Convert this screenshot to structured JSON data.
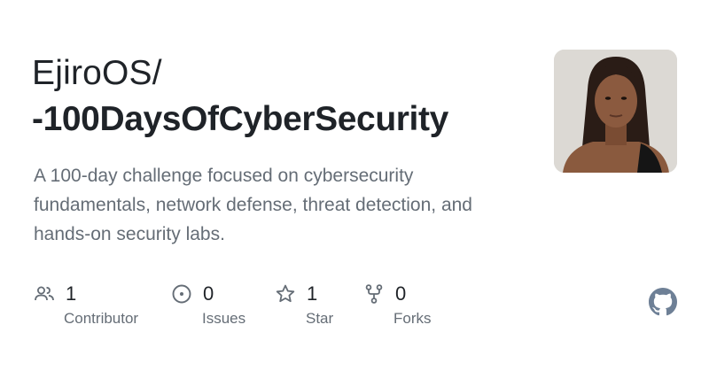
{
  "repo_card": {
    "owner": "EjiroOS/",
    "name": "-100DaysOfCyberSecurity",
    "description": "A 100-day challenge focused on cybersecurity fundamentals, network defense, threat detection, and hands-on security labs.",
    "avatar_icon": "user-avatar-photo",
    "stats": [
      {
        "icon": "people-icon",
        "value": "1",
        "label": "Contributor"
      },
      {
        "icon": "issue-opened-icon",
        "value": "0",
        "label": "Issues"
      },
      {
        "icon": "star-icon",
        "value": "1",
        "label": "Star"
      },
      {
        "icon": "repo-forked-icon",
        "value": "0",
        "label": "Forks"
      }
    ],
    "brand_icon": "github-logo-icon"
  },
  "colors": {
    "title": "#1f2328",
    "muted": "#656d76",
    "icon": "#656d76",
    "logo": "#6e8096"
  }
}
